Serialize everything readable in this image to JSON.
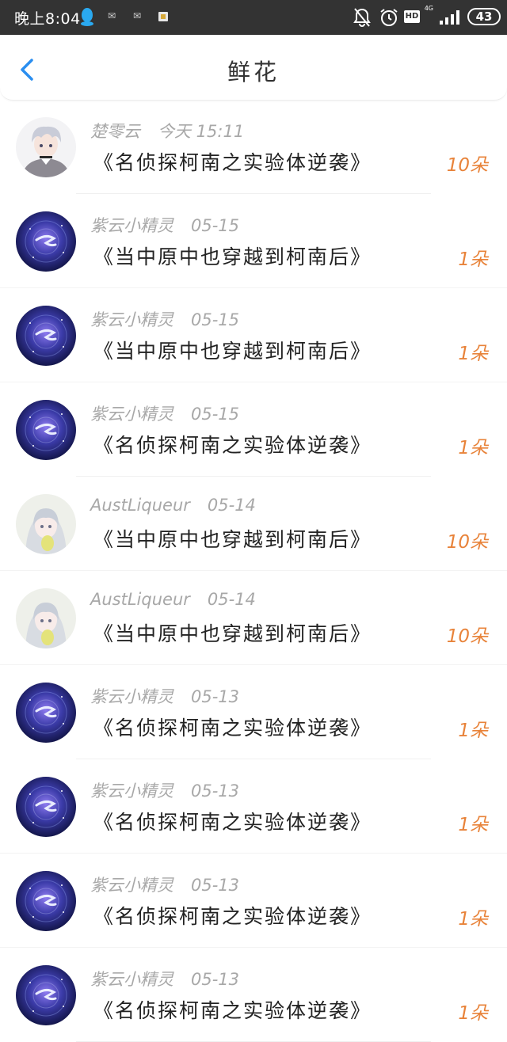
{
  "status_bar": {
    "time": "晚上8:04",
    "notif_1": "✉",
    "notif_2": "✉",
    "network": "4G",
    "hd": "HD",
    "battery": "43"
  },
  "header": {
    "title": "鲜花",
    "back_icon": "chevron-left-icon"
  },
  "colors": {
    "accent": "#2a8ef0",
    "amount": "#e8833a",
    "status_bar": "#333333"
  },
  "flowers": [
    {
      "sender": "楚零云",
      "date": "今天 15:11",
      "title": "《名侦探柯南之实验体逆袭》",
      "amount": "10朵",
      "avatar": "anime-boy"
    },
    {
      "sender": "紫云小精灵",
      "date": "05-15",
      "title": "《当中原中也穿越到柯南后》",
      "amount": "1朵",
      "avatar": "galaxy"
    },
    {
      "sender": "紫云小精灵",
      "date": "05-15",
      "title": "《当中原中也穿越到柯南后》",
      "amount": "1朵",
      "avatar": "galaxy"
    },
    {
      "sender": "紫云小精灵",
      "date": "05-15",
      "title": "《名侦探柯南之实验体逆袭》",
      "amount": "1朵",
      "avatar": "galaxy"
    },
    {
      "sender": "AustLiqueur",
      "date": "05-14",
      "title": "《当中原中也穿越到柯南后》",
      "amount": "10朵",
      "avatar": "anime-girl"
    },
    {
      "sender": "AustLiqueur",
      "date": "05-14",
      "title": "《当中原中也穿越到柯南后》",
      "amount": "10朵",
      "avatar": "anime-girl"
    },
    {
      "sender": "紫云小精灵",
      "date": "05-13",
      "title": "《名侦探柯南之实验体逆袭》",
      "amount": "1朵",
      "avatar": "galaxy"
    },
    {
      "sender": "紫云小精灵",
      "date": "05-13",
      "title": "《名侦探柯南之实验体逆袭》",
      "amount": "1朵",
      "avatar": "galaxy"
    },
    {
      "sender": "紫云小精灵",
      "date": "05-13",
      "title": "《名侦探柯南之实验体逆袭》",
      "amount": "1朵",
      "avatar": "galaxy"
    },
    {
      "sender": "紫云小精灵",
      "date": "05-13",
      "title": "《名侦探柯南之实验体逆袭》",
      "amount": "1朵",
      "avatar": "galaxy"
    }
  ]
}
